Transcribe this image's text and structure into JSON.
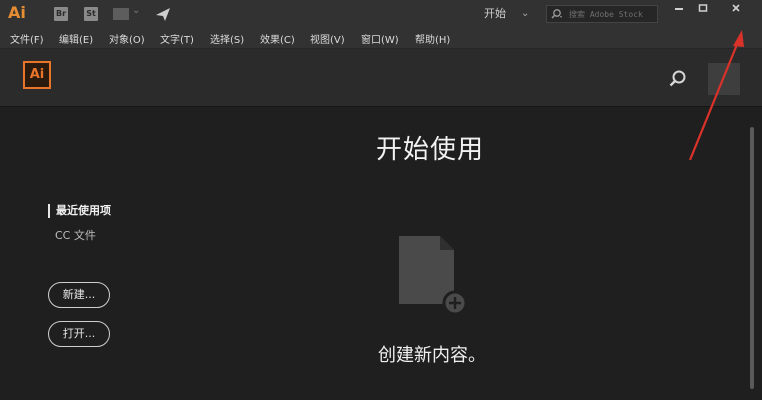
{
  "titlebar": {
    "logo": "Ai",
    "bridge_label": "Br",
    "stock_label": "St",
    "workspace_label": "开始",
    "stock_search_placeholder": "搜索 Adobe Stock",
    "icons": [
      "arrange-documents-icon",
      "gpu-performance-icon",
      "search-icon",
      "minimize-icon",
      "maximize-icon",
      "close-icon"
    ]
  },
  "menu": {
    "items": [
      "文件(F)",
      "编辑(E)",
      "对象(O)",
      "文字(T)",
      "选择(S)",
      "效果(C)",
      "视图(V)",
      "窗口(W)",
      "帮助(H)"
    ]
  },
  "home": {
    "badge": "Ai",
    "heading": "开始使用",
    "nav": {
      "recent": "最近使用项",
      "cc_files": "CC 文件"
    },
    "new_button": "新建...",
    "open_button": "打开...",
    "create_text": "创建新内容。"
  },
  "colors": {
    "accent": "#e8752a",
    "annotation_arrow": "#d9322a",
    "background": "#1f1f1f"
  }
}
